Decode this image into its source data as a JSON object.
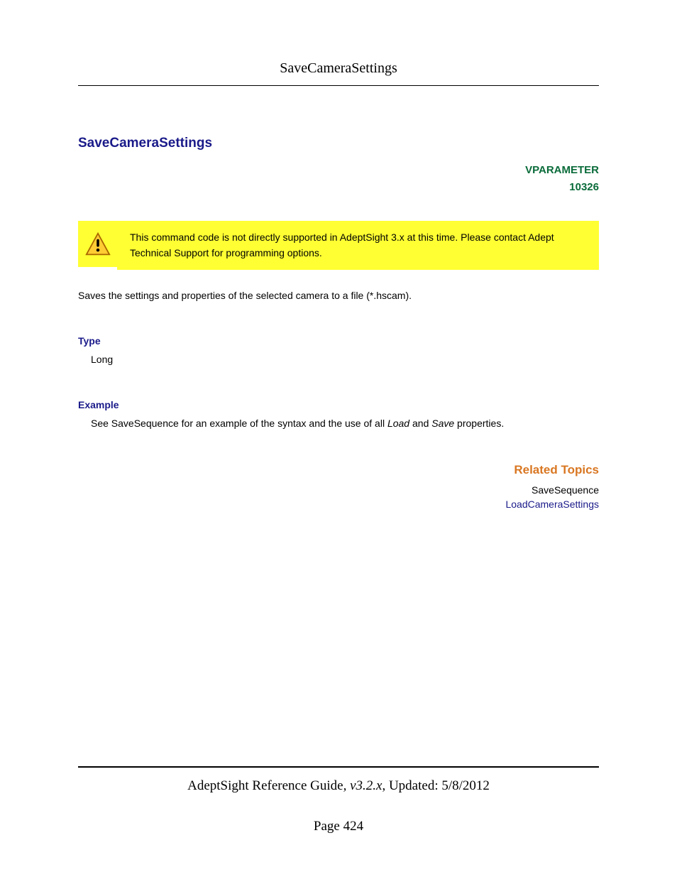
{
  "header": {
    "title": "SaveCameraSettings"
  },
  "main": {
    "title": "SaveCameraSettings",
    "vparameter_label": "VPARAMETER",
    "vparameter_code": "10326",
    "warning_text": "This command code is not directly supported in AdeptSight 3.x at this time. Please contact Adept Technical Support for programming options.",
    "description": "Saves the settings and properties of the selected camera to a file (*.hscam).",
    "type_label": "Type",
    "type_value": "Long",
    "example_label": "Example",
    "example_prefix": "See SaveSequence for an example of the syntax and the use of all ",
    "example_italic1": "Load",
    "example_mid": " and ",
    "example_italic2": "Save",
    "example_suffix": " properties.",
    "related_title": "Related Topics",
    "related_items": [
      {
        "label": "SaveSequence",
        "link": false
      },
      {
        "label": "LoadCameraSettings",
        "link": true
      }
    ]
  },
  "footer": {
    "guide": "AdeptSight Reference Guide",
    "version": ", v3.2.x",
    "updated": ", Updated: 5/8/2012",
    "page": "Page 424"
  }
}
